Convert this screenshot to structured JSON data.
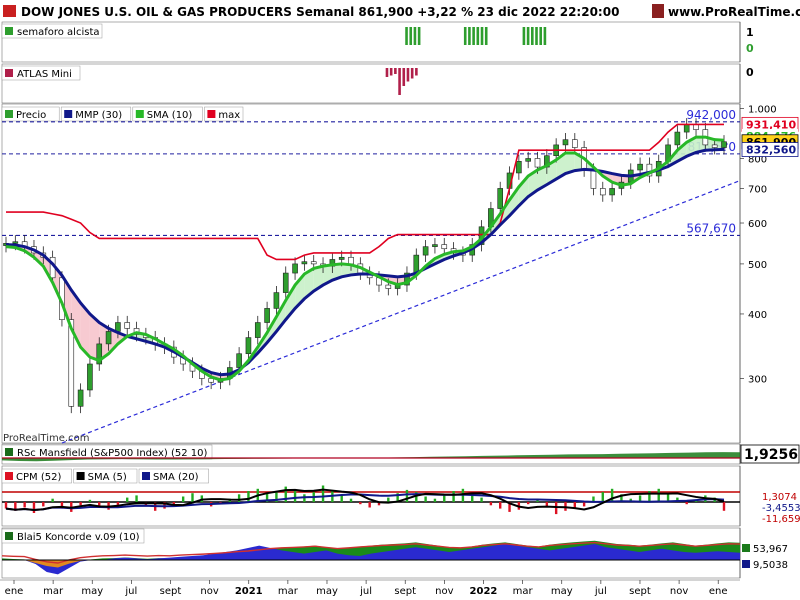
{
  "header": {
    "title": "DOW JONES U.S. OIL & GAS PRODUCERS Semanal 861,900 +3,22 % 23 dic 2022 22:20:00",
    "website": "www.ProRealTime.com",
    "watermark": "ProRealTime.com"
  },
  "chart_data": [
    {
      "type": "bar",
      "panel": "semaforo",
      "title": "semaforo alcista",
      "right_labels": [
        "1",
        "0"
      ],
      "signal_clusters": [
        {
          "start": "2021-sept",
          "bars": 4
        },
        {
          "start": "2021-dic",
          "bars": 6
        },
        {
          "start": "2022-mar",
          "bars": 6
        }
      ],
      "signal_color": "#2e9e2e"
    },
    {
      "type": "bar",
      "panel": "atlas",
      "title": "ATLAS Mini",
      "right_labels": [
        "0"
      ],
      "bar_values": [
        -0.3,
        -0.25,
        -0.2,
        -0.9,
        -0.6,
        -0.45,
        -0.35,
        -0.25
      ],
      "signal_color": "#b0204a"
    },
    {
      "type": "line",
      "panel": "precio",
      "legend": [
        {
          "name": "Precio",
          "color": "#2e9e2e"
        },
        {
          "name": "MMP (30)",
          "color": "#10188a"
        },
        {
          "name": "SMA (10)",
          "color": "#28b828"
        },
        {
          "name": "max",
          "color": "#e00020"
        }
      ],
      "x_ticks": [
        "ene",
        "mar",
        "may",
        "jul",
        "sept",
        "nov",
        "2021",
        "mar",
        "may",
        "jul",
        "sept",
        "nov",
        "2022",
        "mar",
        "may",
        "jul",
        "sept",
        "nov",
        "ene"
      ],
      "y_ticks": [
        "300",
        "400",
        "500",
        "600",
        "700",
        "800",
        "1.000"
      ],
      "scale": "log",
      "ylim": [
        225,
        1020
      ],
      "series": [
        {
          "name": "Precio",
          "values": [
            548,
            552,
            540,
            525,
            515,
            470,
            390,
            265,
            285,
            320,
            350,
            370,
            385,
            375,
            365,
            360,
            350,
            345,
            330,
            320,
            310,
            300,
            295,
            300,
            315,
            335,
            360,
            385,
            410,
            440,
            480,
            500,
            505,
            500,
            495,
            510,
            515,
            500,
            480,
            470,
            455,
            448,
            455,
            480,
            520,
            540,
            545,
            535,
            525,
            520,
            545,
            590,
            640,
            700,
            750,
            790,
            800,
            770,
            810,
            850,
            870,
            840,
            760,
            700,
            680,
            700,
            720,
            760,
            780,
            740,
            790,
            850,
            900,
            930,
            910,
            850,
            840,
            862
          ]
        },
        {
          "name": "SMA (10)",
          "values": [
            540,
            538,
            530,
            515,
            495,
            460,
            420,
            375,
            345,
            330,
            325,
            335,
            350,
            362,
            368,
            365,
            358,
            350,
            342,
            332,
            320,
            310,
            302,
            298,
            300,
            310,
            325,
            345,
            368,
            395,
            425,
            455,
            478,
            490,
            495,
            498,
            500,
            498,
            492,
            482,
            472,
            462,
            456,
            460,
            475,
            495,
            512,
            522,
            528,
            530,
            540,
            560,
            590,
            625,
            665,
            705,
            740,
            760,
            775,
            795,
            820,
            820,
            800,
            770,
            740,
            720,
            710,
            715,
            735,
            750,
            765,
            790,
            830,
            860,
            880,
            880,
            870,
            868
          ]
        },
        {
          "name": "MMP (30)",
          "values": [
            545,
            544,
            540,
            532,
            520,
            500,
            475,
            445,
            420,
            400,
            385,
            375,
            368,
            362,
            358,
            354,
            350,
            345,
            338,
            330,
            322,
            314,
            308,
            305,
            306,
            312,
            322,
            336,
            352,
            370,
            390,
            410,
            428,
            443,
            455,
            465,
            472,
            476,
            478,
            478,
            476,
            474,
            472,
            474,
            480,
            490,
            500,
            510,
            518,
            525,
            535,
            550,
            570,
            595,
            620,
            648,
            675,
            695,
            712,
            730,
            748,
            758,
            762,
            760,
            755,
            748,
            742,
            740,
            745,
            752,
            760,
            772,
            790,
            808,
            822,
            830,
            832,
            833
          ]
        },
        {
          "name": "max",
          "values": [
            630,
            630,
            630,
            630,
            630,
            625,
            620,
            610,
            600,
            575,
            560,
            560,
            560,
            560,
            560,
            560,
            560,
            560,
            560,
            560,
            560,
            560,
            560,
            560,
            560,
            560,
            560,
            560,
            520,
            510,
            510,
            510,
            520,
            525,
            525,
            525,
            525,
            525,
            525,
            525,
            540,
            560,
            570,
            570,
            570,
            570,
            570,
            570,
            570,
            570,
            570,
            570,
            570,
            600,
            700,
            830,
            830,
            830,
            830,
            830,
            830,
            830,
            830,
            830,
            830,
            830,
            830,
            830,
            830,
            830,
            860,
            900,
            931,
            931,
            931,
            931,
            931,
            931
          ]
        }
      ],
      "horizontal_levels": [
        {
          "value": 942,
          "label": "942,000",
          "color": "#2b2bd8"
        },
        {
          "value": 816.6,
          "label": "816,6?0",
          "color": "#2b2bd8"
        },
        {
          "value": 567.67,
          "label": "567,670",
          "color": "#2b2bd8"
        }
      ],
      "trendline": {
        "from": [
          6,
          225
        ],
        "to": [
          78,
          725
        ],
        "color": "#2b2bd8"
      },
      "right_value_labels": [
        {
          "label": "931,410",
          "value": 931.41,
          "bg": "#ffffff",
          "fg": "#e00020",
          "border": "#e00020"
        },
        {
          "label": "884,476",
          "value": 884.476,
          "bg": "#ffffff",
          "fg": "#28b828",
          "border": "none"
        },
        {
          "label": "861,900",
          "value": 861.9,
          "bg": "#ffd21a",
          "fg": "#000000",
          "border": "#000000"
        },
        {
          "label": "832,560",
          "value": 832.56,
          "bg": "#ffffff",
          "fg": "#10188a",
          "border": "#10188a"
        }
      ]
    },
    {
      "type": "area",
      "panel": "mansfield",
      "title": "RSc Mansfield (S&P500 Index) (52 10)",
      "last_value": "1,9256",
      "values": [
        -0.8,
        -1.0,
        -1.1,
        -0.9,
        -0.7,
        -0.5,
        -0.4,
        -0.35,
        -0.4,
        -0.5,
        -0.5,
        -0.45,
        -0.4,
        -0.35,
        -0.3,
        -0.25,
        -0.2,
        -0.15,
        -0.1,
        -0.05,
        0.0,
        0.05,
        0.1,
        0.2,
        0.3,
        0.4,
        0.5,
        0.6,
        0.7,
        0.8,
        0.9,
        1.0,
        1.1,
        1.2,
        1.25,
        1.3,
        1.4,
        1.5,
        1.6,
        1.7,
        1.8,
        1.9,
        1.95,
        1.9
      ]
    },
    {
      "type": "bar",
      "panel": "cpm",
      "title": "CPM (52)",
      "legend": [
        {
          "name": "SMA (5)",
          "color": "#000000"
        },
        {
          "name": "SMA (20)",
          "color": "#10188a"
        }
      ],
      "labels": [
        "1,3074",
        "-3,4553",
        "-11,659"
      ],
      "values": [
        -6,
        -8,
        -5,
        -10,
        -4,
        3,
        -6,
        -9,
        -3,
        2,
        -4,
        -7,
        -5,
        4,
        6,
        -3,
        -8,
        -6,
        -2,
        5,
        8,
        6,
        -4,
        -2,
        3,
        7,
        10,
        12,
        8,
        10,
        14,
        11,
        7,
        9,
        15,
        10,
        6,
        3,
        -2,
        -5,
        -3,
        4,
        8,
        11,
        9,
        5,
        3,
        6,
        10,
        12,
        8,
        4,
        -3,
        -6,
        -9,
        -7,
        -2,
        2,
        -5,
        -11,
        -8,
        -6,
        -4,
        5,
        9,
        12,
        7,
        3,
        6,
        10,
        12,
        7,
        4,
        -2,
        2,
        6,
        4,
        -8
      ]
    },
    {
      "type": "area",
      "panel": "koncorde",
      "title": "Blai5 Koncorde v.09 (10)",
      "labels": [
        "53,967",
        "9,5038"
      ],
      "green_values": [
        5,
        3,
        2,
        -10,
        -20,
        -25,
        -12,
        -3,
        2,
        5,
        6,
        8,
        6,
        4,
        6,
        5,
        8,
        10,
        12,
        15,
        18,
        22,
        25,
        30,
        35,
        38,
        40,
        42,
        45,
        40,
        35,
        38,
        42,
        45,
        48,
        50,
        52,
        55,
        50,
        45,
        40,
        38,
        42,
        48,
        52,
        55,
        50,
        45,
        42,
        48,
        52,
        55,
        58,
        60,
        55,
        50,
        48,
        45,
        48,
        52,
        55,
        50,
        45,
        48,
        52,
        55,
        54
      ],
      "blue_values": [
        0,
        0,
        0,
        -5,
        -15,
        -18,
        -10,
        -2,
        0,
        0,
        2,
        3,
        2,
        1,
        2,
        3,
        4,
        5,
        6,
        8,
        10,
        12,
        15,
        18,
        15,
        12,
        10,
        8,
        10,
        12,
        8,
        6,
        5,
        8,
        10,
        12,
        14,
        16,
        14,
        12,
        10,
        12,
        14,
        16,
        18,
        20,
        18,
        16,
        14,
        12,
        14,
        16,
        18,
        20,
        16,
        14,
        12,
        10,
        12,
        14,
        12,
        10,
        9,
        10,
        11,
        10,
        9
      ]
    }
  ]
}
